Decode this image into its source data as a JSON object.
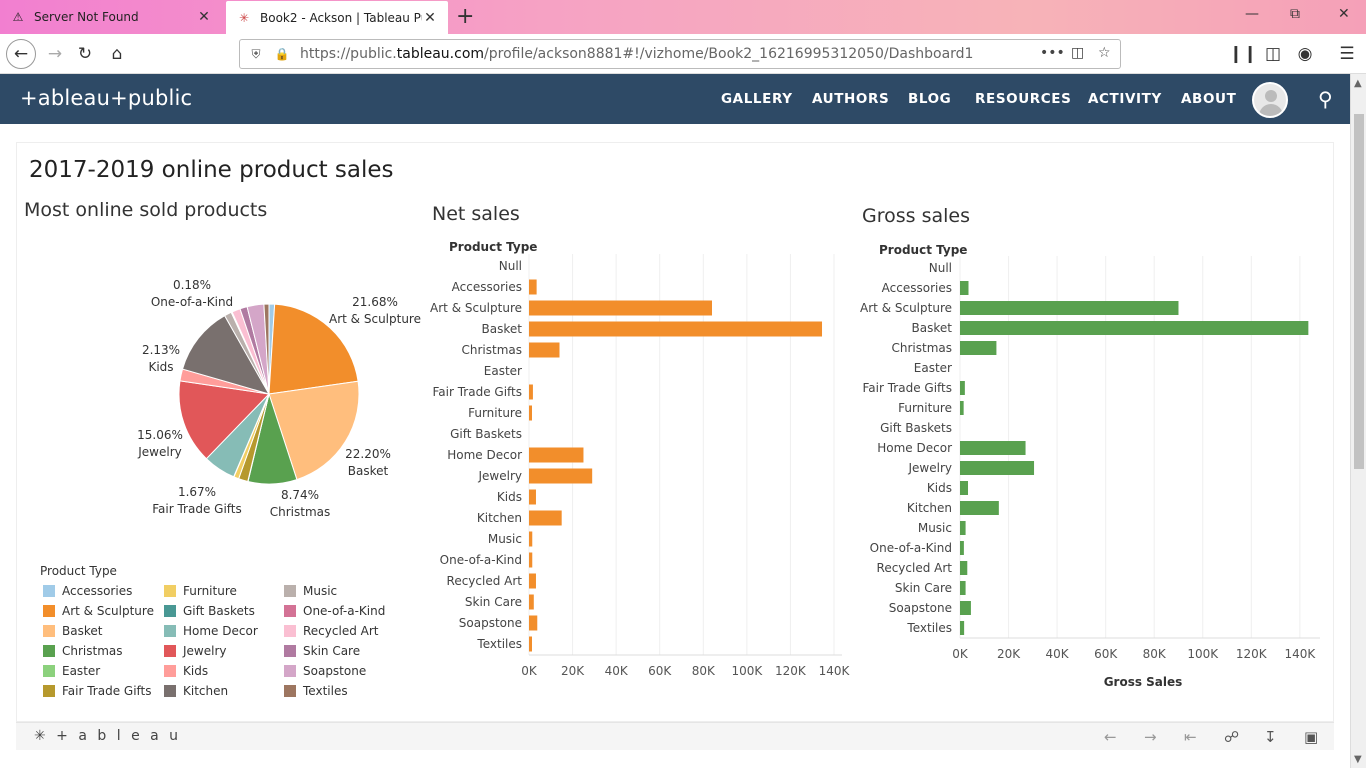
{
  "browser": {
    "tabs": [
      {
        "label": "Server Not Found",
        "icon": "warning-icon"
      },
      {
        "label": "Book2 - Ackson | Tableau Publ",
        "icon": "tableau-icon"
      }
    ],
    "url_prefix": "https://public.",
    "url_domain": "tableau.com",
    "url_rest": "/profile/ackson8881#!/vizhome/Book2_16216995312050/Dashboard1"
  },
  "header": {
    "logo": "+ableau+public",
    "nav": [
      "GALLERY",
      "AUTHORS",
      "BLOG",
      "RESOURCES",
      "ACTIVITY",
      "ABOUT"
    ]
  },
  "dashboard": {
    "title": "2017-2019 online product sales",
    "pie_title": "Most online sold products",
    "net_title": "Net sales",
    "gross_title": "Gross sales",
    "product_type_label": "Product Type",
    "gross_axis_label": "Gross Sales"
  },
  "colors": {
    "orange": "#f28e2b",
    "green": "#59a14f",
    "header": "#2e4a66"
  },
  "chart_data": [
    {
      "type": "pie",
      "title": "Most online sold products",
      "slices": [
        {
          "label": "Accessories",
          "value": 1.0,
          "color": "#a0cbe8"
        },
        {
          "label": "Art & Sculpture",
          "value": 21.68,
          "color": "#f28e2b"
        },
        {
          "label": "Basket",
          "value": 22.2,
          "color": "#ffbe7d"
        },
        {
          "label": "Christmas",
          "value": 8.74,
          "color": "#59a14f"
        },
        {
          "label": "Easter",
          "value": 0.05,
          "color": "#8cd17d"
        },
        {
          "label": "Fair Trade Gifts",
          "value": 1.67,
          "color": "#b6992d"
        },
        {
          "label": "Furniture",
          "value": 0.9,
          "color": "#f1ce63"
        },
        {
          "label": "Gift Baskets",
          "value": 0.05,
          "color": "#499894"
        },
        {
          "label": "Home Decor",
          "value": 5.8,
          "color": "#86bcb6"
        },
        {
          "label": "Jewelry",
          "value": 15.06,
          "color": "#e15759"
        },
        {
          "label": "Kids",
          "value": 2.13,
          "color": "#ff9d9a"
        },
        {
          "label": "Kitchen",
          "value": 12.3,
          "color": "#79706e"
        },
        {
          "label": "Music",
          "value": 1.3,
          "color": "#bab0ac"
        },
        {
          "label": "One-of-a-Kind",
          "value": 0.18,
          "color": "#d37295"
        },
        {
          "label": "Recycled Art",
          "value": 1.5,
          "color": "#fabfd2"
        },
        {
          "label": "Skin Care",
          "value": 1.3,
          "color": "#b07aa1"
        },
        {
          "label": "Soapstone",
          "value": 3.0,
          "color": "#d4a6c8"
        },
        {
          "label": "Textiles",
          "value": 0.9,
          "color": "#9d7660"
        }
      ],
      "labels_shown": [
        {
          "pct": "21.68%",
          "name": "Art & Sculpture"
        },
        {
          "pct": "22.20%",
          "name": "Basket"
        },
        {
          "pct": "8.74%",
          "name": "Christmas"
        },
        {
          "pct": "1.67%",
          "name": "Fair Trade Gifts"
        },
        {
          "pct": "15.06%",
          "name": "Jewelry"
        },
        {
          "pct": "2.13%",
          "name": "Kids"
        },
        {
          "pct": "0.18%",
          "name": "One-of-a-Kind"
        }
      ]
    },
    {
      "type": "bar",
      "title": "Net sales",
      "orientation": "horizontal",
      "categories": [
        "Null",
        "Accessories",
        "Art & Sculpture",
        "Basket",
        "Christmas",
        "Easter",
        "Fair Trade Gifts",
        "Furniture",
        "Gift Baskets",
        "Home Decor",
        "Jewelry",
        "Kids",
        "Kitchen",
        "Music",
        "One-of-a-Kind",
        "Recycled Art",
        "Skin Care",
        "Soapstone",
        "Textiles"
      ],
      "values": [
        0,
        3500,
        84000,
        134500,
        14000,
        0,
        1800,
        1300,
        0,
        25000,
        29000,
        3200,
        15000,
        1500,
        1500,
        3200,
        2200,
        3800,
        1100
      ],
      "xticks": [
        "0K",
        "20K",
        "40K",
        "60K",
        "80K",
        "100K",
        "120K",
        "140K"
      ],
      "xlim": [
        0,
        140000
      ],
      "color": "#f28e2b"
    },
    {
      "type": "bar",
      "title": "Gross sales",
      "orientation": "horizontal",
      "categories": [
        "Null",
        "Accessories",
        "Art & Sculpture",
        "Basket",
        "Christmas",
        "Easter",
        "Fair Trade Gifts",
        "Furniture",
        "Gift Baskets",
        "Home Decor",
        "Jewelry",
        "Kids",
        "Kitchen",
        "Music",
        "One-of-a-Kind",
        "Recycled Art",
        "Skin Care",
        "Soapstone",
        "Textiles"
      ],
      "values": [
        0,
        3500,
        90000,
        143500,
        15000,
        0,
        2000,
        1500,
        0,
        27000,
        30500,
        3300,
        16000,
        2300,
        1600,
        3000,
        2300,
        4500,
        1700
      ],
      "xticks": [
        "0K",
        "20K",
        "40K",
        "60K",
        "80K",
        "100K",
        "120K",
        "140K"
      ],
      "xlabel": "Gross Sales",
      "xlim": [
        0,
        145000
      ],
      "color": "#59a14f"
    }
  ]
}
